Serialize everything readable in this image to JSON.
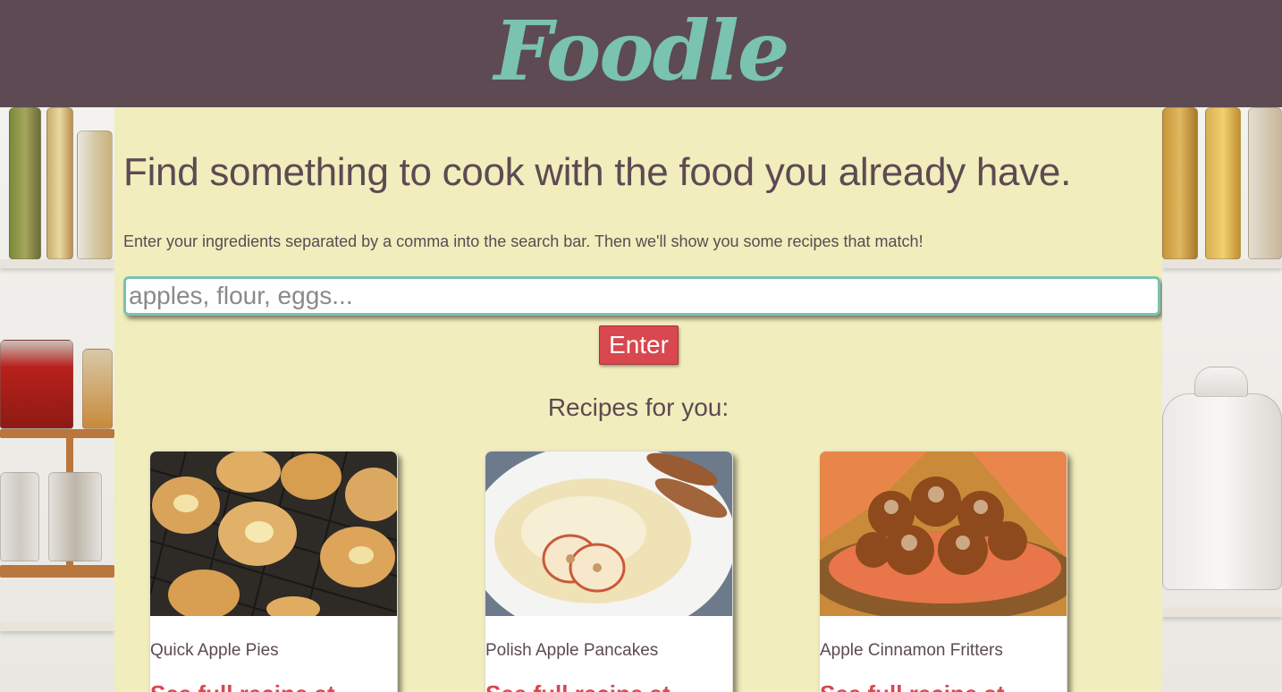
{
  "header": {
    "logo_text": "Foodle"
  },
  "hero": {
    "headline": "Find something to cook with the food you already have.",
    "instructions": "Enter your ingredients separated by a comma into the search bar. Then we'll show you some recipes that match!"
  },
  "search": {
    "placeholder": "apples, flour, eggs...",
    "value": "",
    "button_label": "Enter"
  },
  "results": {
    "heading": "Recipes for you:",
    "recipes": [
      {
        "title": "Quick Apple Pies",
        "link_text": "See full recipe at"
      },
      {
        "title": "Polish Apple Pancakes",
        "link_text": "See full recipe at"
      },
      {
        "title": "Apple Cinnamon Fritters",
        "link_text": "See full recipe at"
      }
    ]
  },
  "colors": {
    "header_bg": "#5d4a52",
    "logo": "#79c3b0",
    "panel_bg": "#f1edbd",
    "text": "#5d4a52",
    "accent_red": "#d9474f",
    "input_border": "#79c3b0"
  }
}
